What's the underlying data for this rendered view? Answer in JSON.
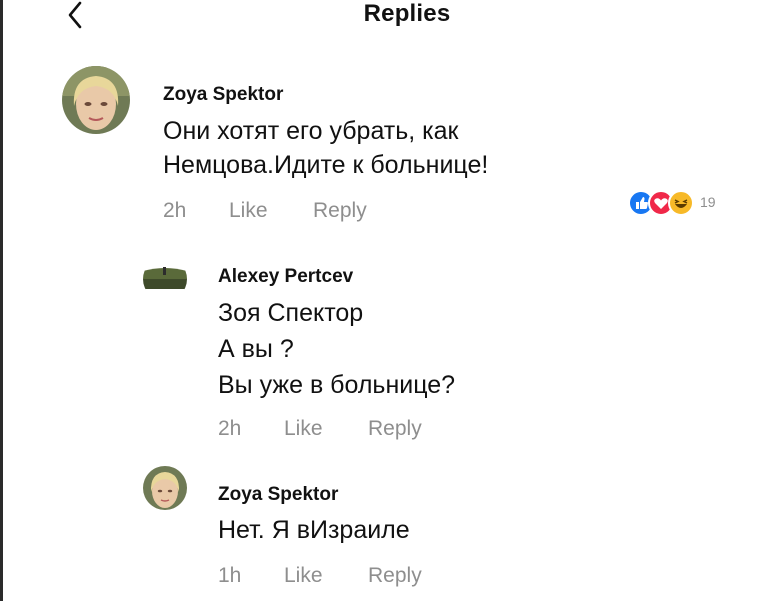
{
  "header": {
    "title": "Replies",
    "back_icon": "chevron-left-icon"
  },
  "comments": [
    {
      "author": "Zoya Spektor",
      "lines": [
        "Они хотят его убрать, как",
        "Немцова.Идите к больнице!"
      ],
      "time": "2h",
      "like_label": "Like",
      "reply_label": "Reply",
      "reactions": {
        "icons": [
          "like-reaction-icon",
          "love-reaction-icon",
          "haha-reaction-icon"
        ],
        "count": "19"
      }
    },
    {
      "author": "Alexey Pertcev",
      "lines": [
        "Зоя Спектор",
        "А вы ?",
        "Вы уже в больнице?"
      ],
      "time": "2h",
      "like_label": "Like",
      "reply_label": "Reply"
    },
    {
      "author": "Zoya Spektor",
      "lines": [
        "Нет. Я вИзраиле"
      ],
      "time": "1h",
      "like_label": "Like",
      "reply_label": "Reply"
    }
  ],
  "colors": {
    "meta_text": "#8e8e8e",
    "like_reaction": "#1877f2",
    "love_reaction": "#f02849",
    "haha_reaction": "#f7b928"
  }
}
